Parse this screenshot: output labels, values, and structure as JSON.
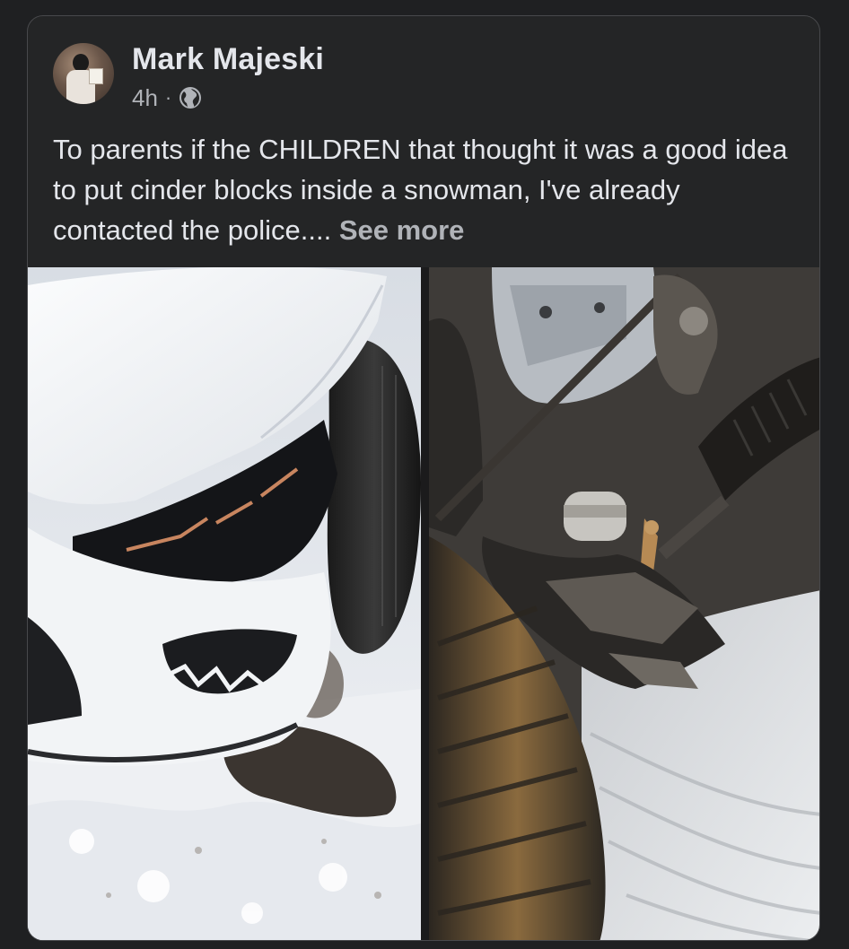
{
  "post": {
    "author": "Mark Majeski",
    "time": "4h",
    "separator": "·",
    "audience_icon": "globe-icon",
    "text": "To parents if the CHILDREN that thought it was a good idea to put cinder blocks inside a snowman, I've already contacted the police....",
    "see_more": "See more"
  },
  "photos": [
    {
      "icon": "photo-car-front-damage"
    },
    {
      "icon": "photo-undercarriage-damage"
    }
  ],
  "colors": {
    "background": "#1f2022",
    "card": "#242526",
    "primary_text": "#e4e6eb",
    "secondary_text": "#b0b3b8"
  }
}
